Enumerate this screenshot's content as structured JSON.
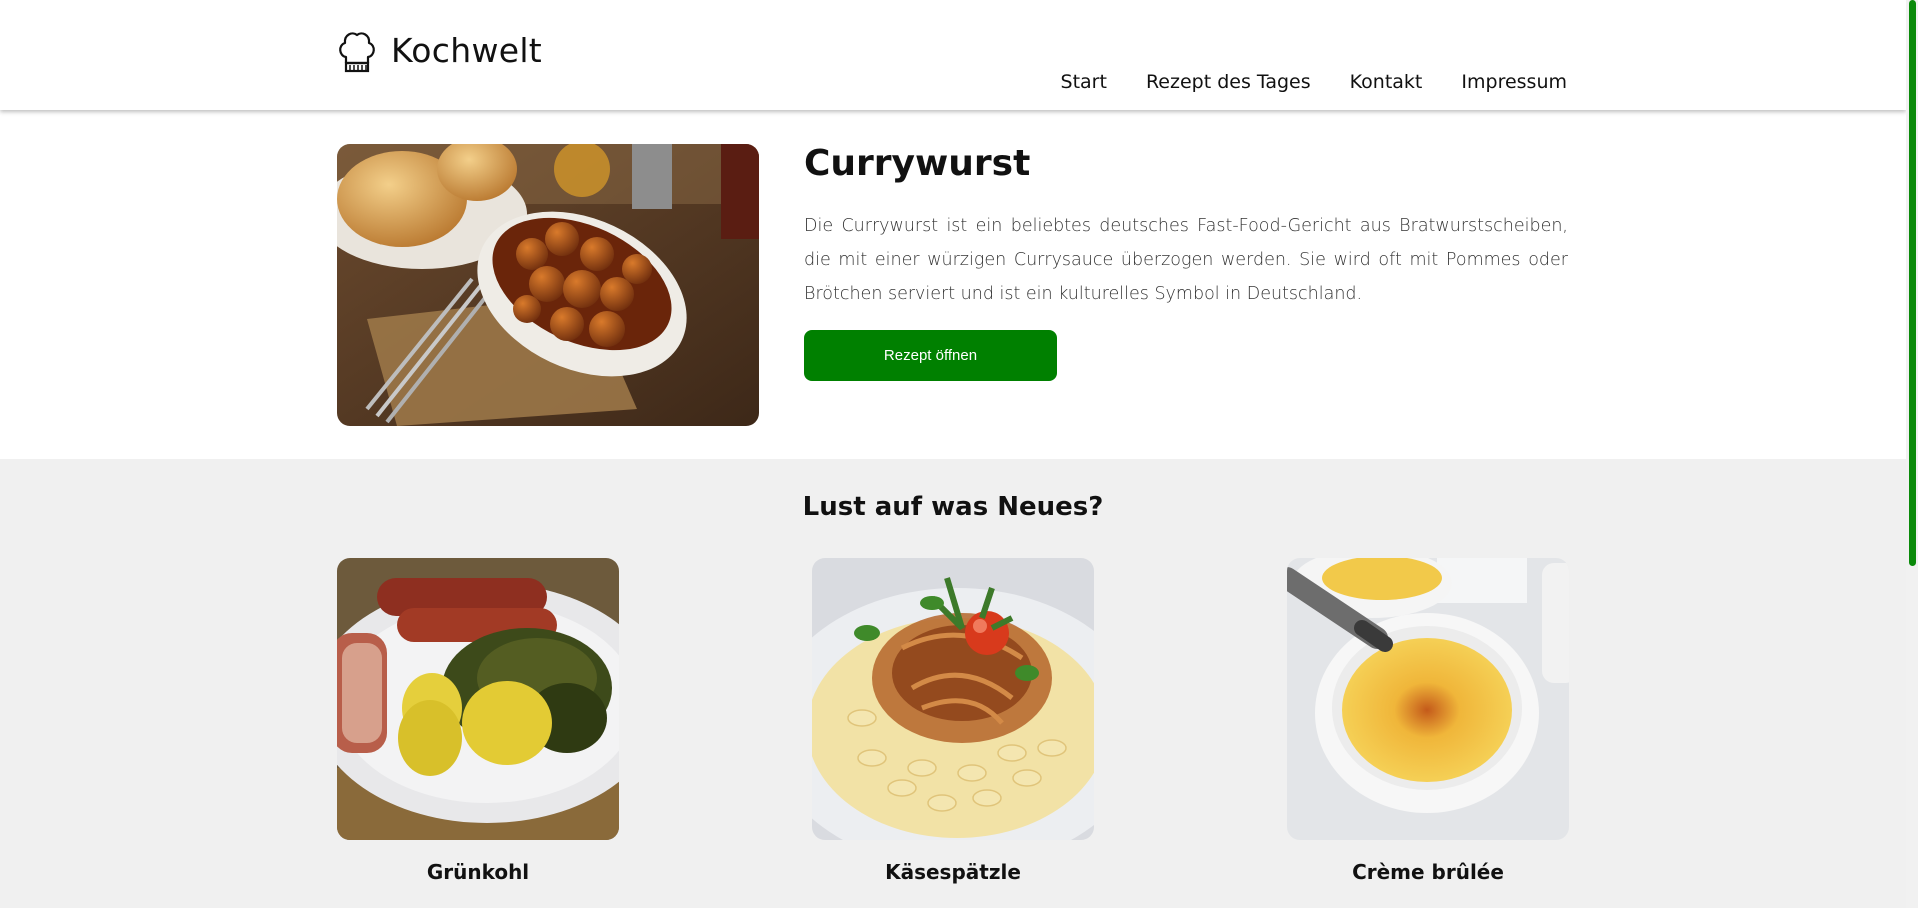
{
  "site": {
    "name": "Kochwelt",
    "logo_icon": "chef-hat-icon"
  },
  "nav": [
    "Start",
    "Rezept des Tages",
    "Kontakt",
    "Impressum"
  ],
  "hero": {
    "title": "Currywurst",
    "description": "Die Currywurst ist ein beliebtes deutsches Fast-Food-Gericht aus Bratwurstscheiben, die mit einer würzigen Currysauce überzogen werden. Sie wird oft mit Pommes oder Brötchen serviert und ist ein kulturelles Symbol in Deutschland.",
    "button": "Rezept öffnen",
    "image": "currywurst-photo"
  },
  "suggestions": {
    "title": "Lust auf was Neues?",
    "cards": [
      {
        "name": "Grünkohl",
        "image": "gruenkohl-photo"
      },
      {
        "name": "Käsespätzle",
        "image": "kaesespaetzle-photo"
      },
      {
        "name": "Crème brûlée",
        "image": "creme-brulee-photo"
      }
    ]
  },
  "colors": {
    "accent": "#008000",
    "section_bg": "#f0f0f0",
    "scrollbar": "#0a8a0a"
  }
}
